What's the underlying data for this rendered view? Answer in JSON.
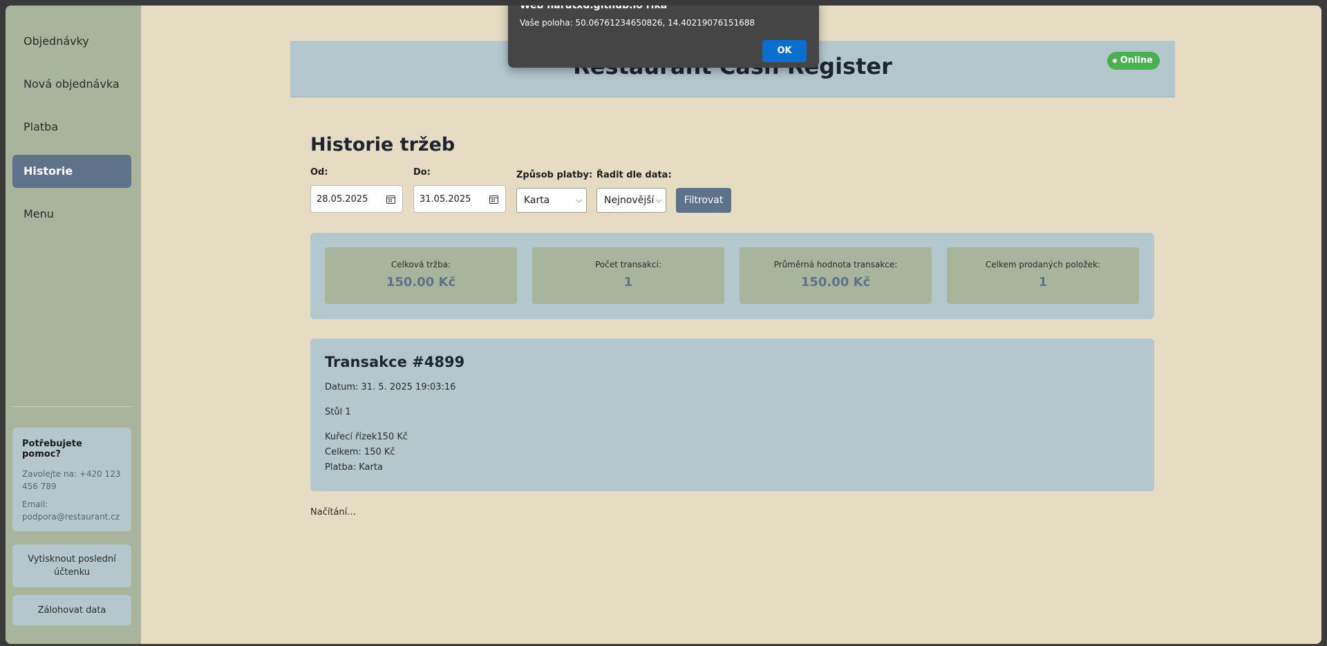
{
  "sidebar": {
    "items": [
      {
        "label": "Objednávky",
        "active": false
      },
      {
        "label": "Nová objednávka",
        "active": false
      },
      {
        "label": "Platba",
        "active": false
      },
      {
        "label": "Historie",
        "active": true
      },
      {
        "label": "Menu",
        "active": false
      }
    ],
    "help": {
      "title": "Potřebujete pomoc?",
      "phone": "Zavolejte na: +420 123 456 789",
      "email": "Email: podpora@restaurant.cz"
    },
    "print_button": "Vytisknout poslední účtenku",
    "backup_button": "Zálohovat data"
  },
  "header": {
    "title": "Restaurant Cash Register",
    "status": "Online",
    "status_color": "#4caf50"
  },
  "history": {
    "title": "Historie tržeb",
    "filters": {
      "from_label": "Od:",
      "from_value": "28.05.2025",
      "to_label": "Do:",
      "to_value": "31.05.2025",
      "payment_label": "Způsob platby:",
      "payment_value": "Karta",
      "sort_label": "Řadit dle data:",
      "sort_value": "Nejnovější",
      "filter_button": "Filtrovat"
    },
    "stats": [
      {
        "label": "Celková tržba:",
        "value": "150.00 Kč"
      },
      {
        "label": "Počet transakcí:",
        "value": "1"
      },
      {
        "label": "Průměrná hodnota transakce:",
        "value": "150.00 Kč"
      },
      {
        "label": "Celkem prodaných položek:",
        "value": "1"
      }
    ],
    "transaction": {
      "title": "Transakce #4899",
      "date": "Datum: 31. 5. 2025 19:03:16",
      "table": "Stůl 1",
      "item": "Kuřecí řízek150 Kč",
      "total": "Celkem: 150 Kč",
      "payment": "Platba: Karta"
    },
    "loading": "Načítání..."
  },
  "dialog": {
    "title": "Web narutxd.github.io říká",
    "message": "Vaše poloha: 50.06761234650826, 14.40219076151688",
    "ok_label": "OK"
  },
  "colors": {
    "sidebar": "#a8b59c",
    "accent": "#5e7389",
    "panel": "#b3c7cd",
    "background": "#e6dcc4"
  }
}
